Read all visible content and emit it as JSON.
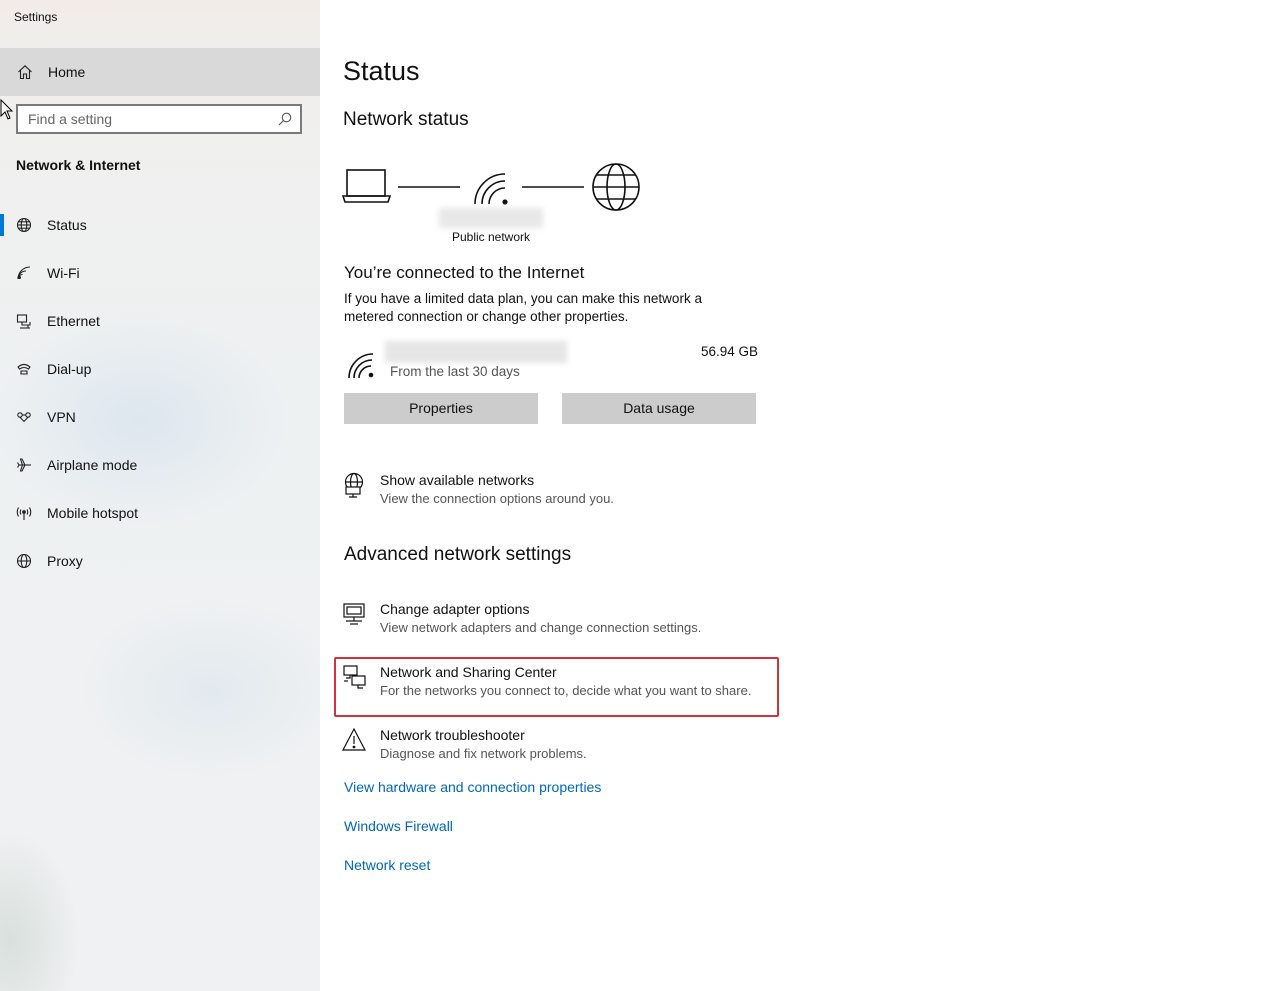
{
  "window": {
    "title": "Settings"
  },
  "sidebar": {
    "home_label": "Home",
    "search": {
      "placeholder": "Find a setting"
    },
    "section_title": "Network & Internet",
    "items": [
      {
        "label": "Status",
        "icon": "globe-status-icon",
        "active": true
      },
      {
        "label": "Wi-Fi",
        "icon": "wifi-icon"
      },
      {
        "label": "Ethernet",
        "icon": "ethernet-icon"
      },
      {
        "label": "Dial-up",
        "icon": "dialup-icon"
      },
      {
        "label": "VPN",
        "icon": "vpn-icon"
      },
      {
        "label": "Airplane mode",
        "icon": "airplane-icon"
      },
      {
        "label": "Mobile hotspot",
        "icon": "hotspot-icon"
      },
      {
        "label": "Proxy",
        "icon": "globe-icon"
      }
    ],
    "accent_color": "#0078d7"
  },
  "main": {
    "title": "Status",
    "network_status_heading": "Network status",
    "network_type": "Public network",
    "connected_heading": "You’re connected to the Internet",
    "connected_desc": "If you have a limited data plan, you can make this network a metered connection or change other properties.",
    "usage": {
      "period": "From the last 30 days",
      "amount": "56.94 GB"
    },
    "buttons": {
      "properties": "Properties",
      "data_usage": "Data usage"
    },
    "show_networks": {
      "title": "Show available networks",
      "subtitle": "View the connection options around you."
    },
    "advanced_heading": "Advanced network settings",
    "advanced_items": [
      {
        "title": "Change adapter options",
        "subtitle": "View network adapters and change connection settings.",
        "icon": "adapter-icon"
      },
      {
        "title": "Network and Sharing Center",
        "subtitle": "For the networks you connect to, decide what you want to share.",
        "icon": "sharing-center-icon",
        "highlighted": true
      },
      {
        "title": "Network troubleshooter",
        "subtitle": "Diagnose and fix network problems.",
        "icon": "warning-icon"
      }
    ],
    "links": [
      "View hardware and connection properties",
      "Windows Firewall",
      "Network reset"
    ],
    "link_color": "#0067b8",
    "highlight_color": "#d13438"
  }
}
